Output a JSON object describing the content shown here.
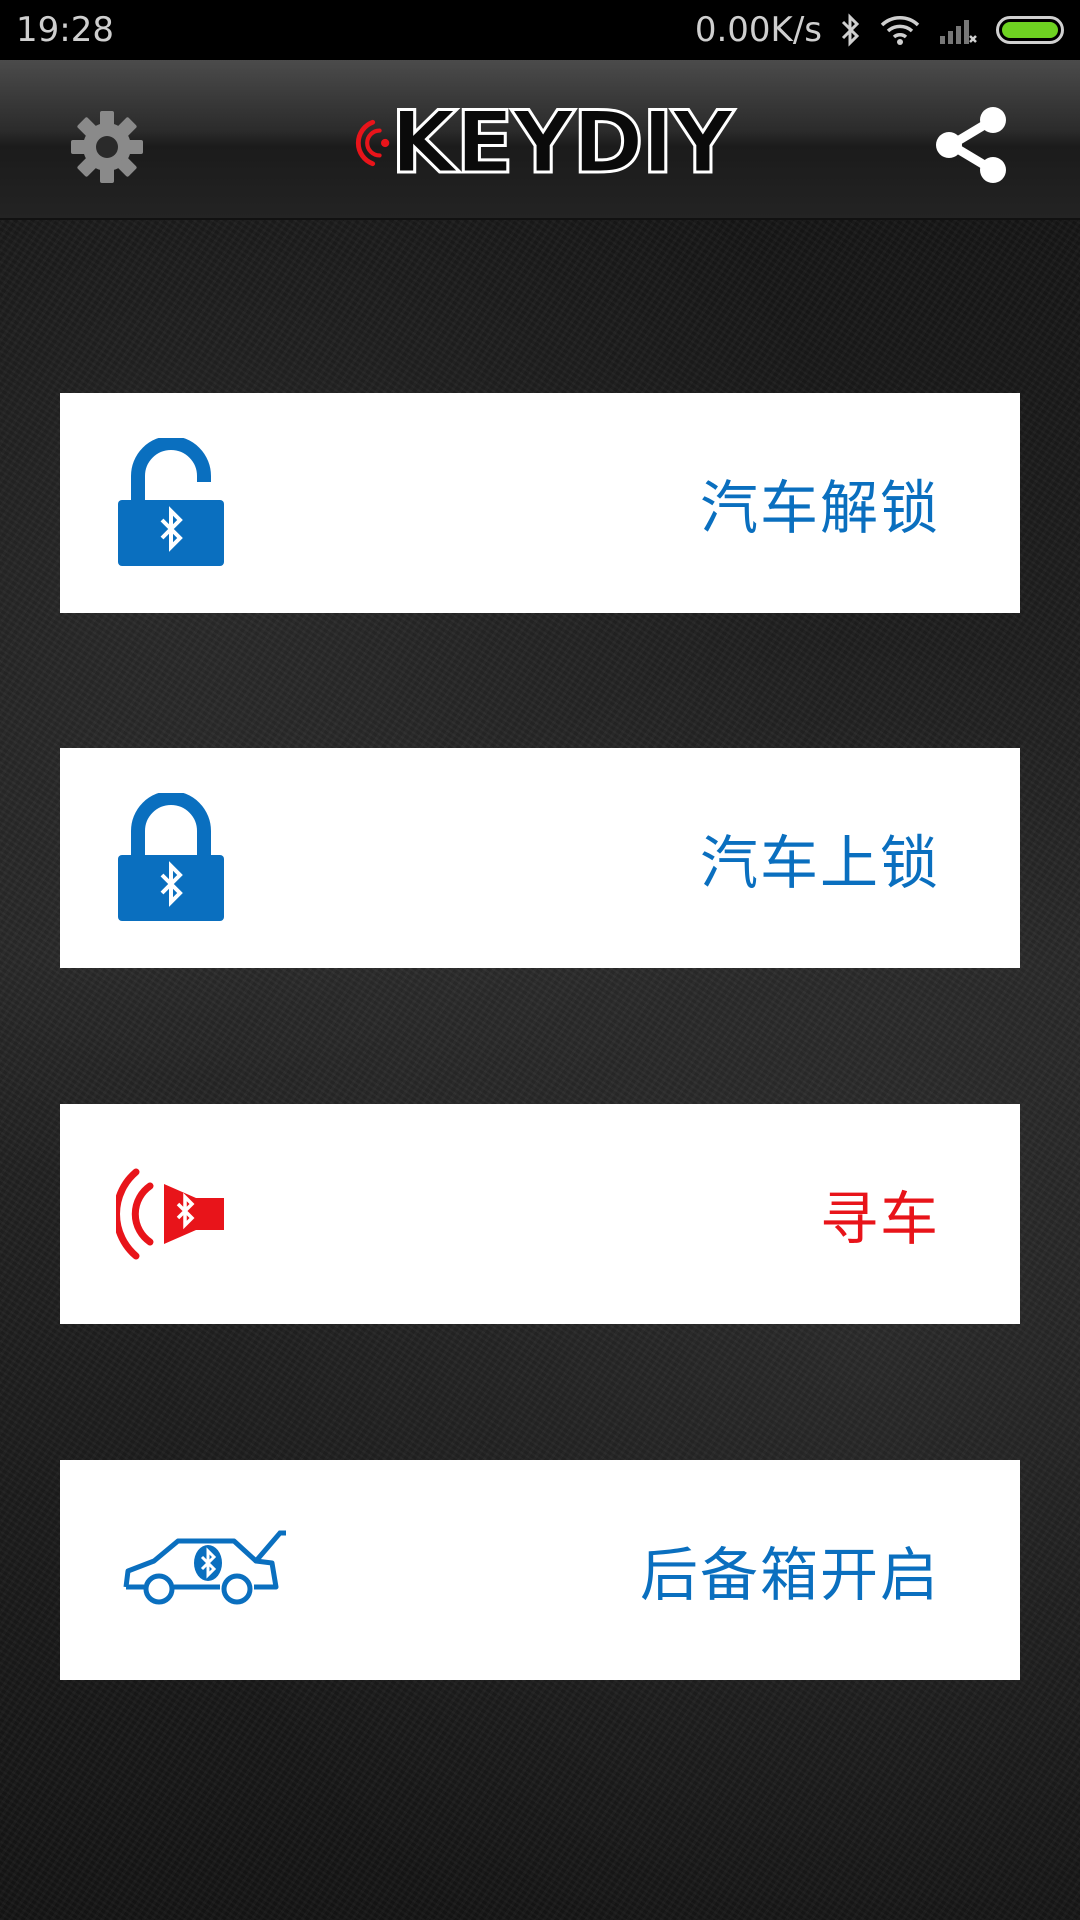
{
  "status_bar": {
    "time": "19:28",
    "net_speed": "0.00K/s",
    "battery_color": "#6ed321"
  },
  "app_bar": {
    "logo_text": "KEYDIY",
    "settings_icon": "gear-icon",
    "share_icon": "share-icon"
  },
  "actions": [
    {
      "label": "汽车解锁",
      "icon": "unlock-bluetooth-icon",
      "color": "#0a6fbf"
    },
    {
      "label": "汽车上锁",
      "icon": "lock-bluetooth-icon",
      "color": "#0a6fbf"
    },
    {
      "label": "寻车",
      "icon": "horn-bluetooth-icon",
      "color": "#e8141a"
    },
    {
      "label": "后备箱开启",
      "icon": "car-trunk-bluetooth-icon",
      "color": "#0a6fbf"
    }
  ],
  "colors": {
    "primary_blue": "#0a6fbf",
    "alert_red": "#e8141a"
  }
}
